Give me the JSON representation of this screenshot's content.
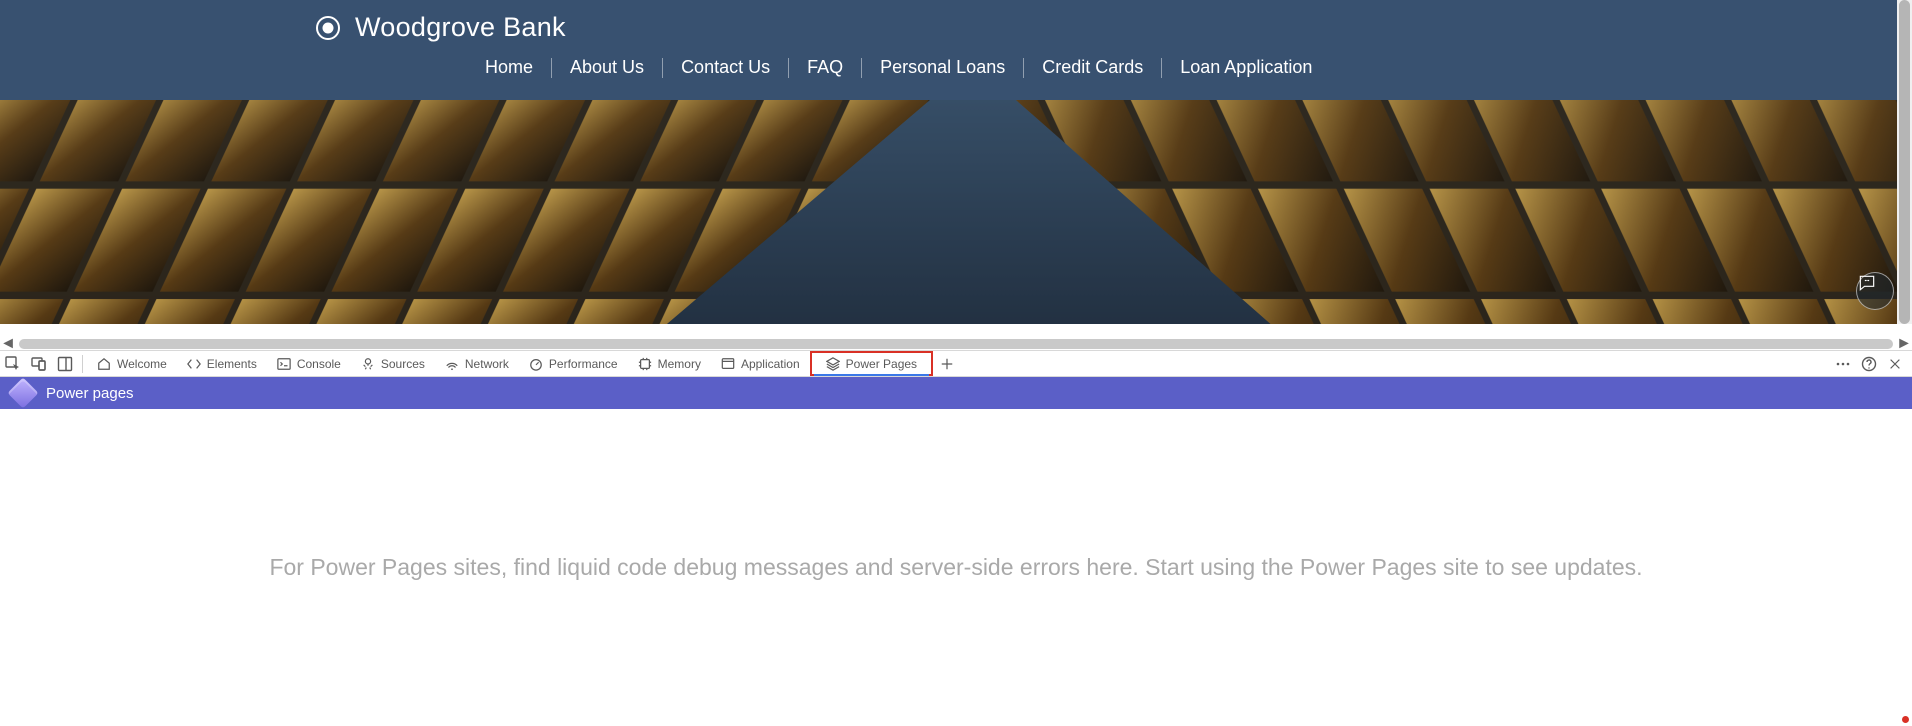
{
  "site": {
    "brand_title": "Woodgrove Bank",
    "nav": [
      "Home",
      "About Us",
      "Contact Us",
      "FAQ",
      "Personal Loans",
      "Credit Cards",
      "Loan Application"
    ]
  },
  "devtools": {
    "tabs": {
      "welcome": "Welcome",
      "elements": "Elements",
      "console": "Console",
      "sources": "Sources",
      "network": "Network",
      "performance": "Performance",
      "memory": "Memory",
      "application": "Application",
      "powerpages": "Power Pages"
    }
  },
  "panel": {
    "title": "Power pages",
    "message": "For Power Pages sites, find liquid code debug messages and server-side errors here. Start using the Power Pages site to see updates."
  }
}
